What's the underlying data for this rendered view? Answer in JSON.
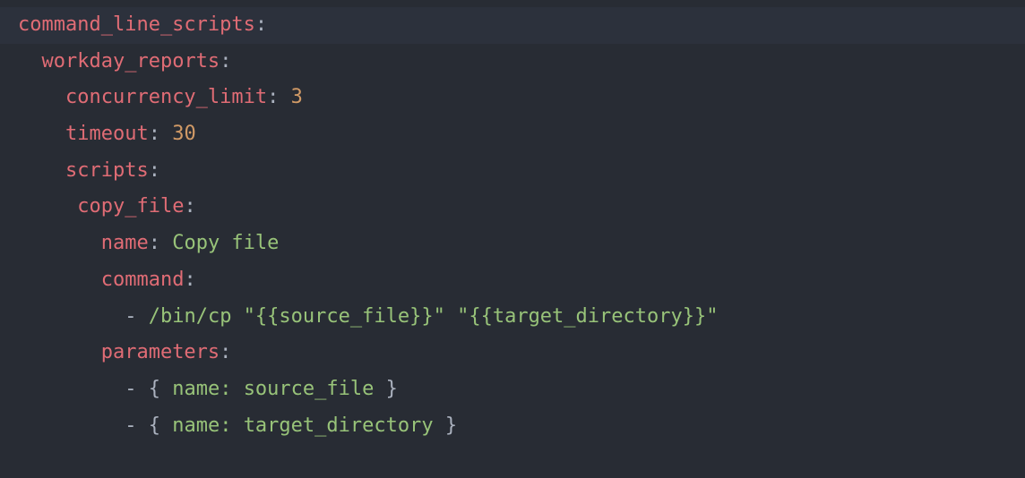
{
  "lines": [
    {
      "indent": 0,
      "highlighted": true,
      "segments": [
        {
          "type": "key",
          "text": "command_line_scripts"
        },
        {
          "type": "colon",
          "text": ":"
        }
      ]
    },
    {
      "indent": 1,
      "segments": [
        {
          "type": "key",
          "text": "workday_reports"
        },
        {
          "type": "colon",
          "text": ":"
        }
      ]
    },
    {
      "indent": 2,
      "segments": [
        {
          "type": "key",
          "text": "concurrency_limit"
        },
        {
          "type": "colon",
          "text": ": "
        },
        {
          "type": "number",
          "text": "3"
        }
      ]
    },
    {
      "indent": 2,
      "segments": [
        {
          "type": "key",
          "text": "timeout"
        },
        {
          "type": "colon",
          "text": ": "
        },
        {
          "type": "number",
          "text": "30"
        }
      ]
    },
    {
      "indent": 2,
      "segments": [
        {
          "type": "key",
          "text": "scripts"
        },
        {
          "type": "colon",
          "text": ":"
        }
      ]
    },
    {
      "indent": 2,
      "extraSpace": 1,
      "segments": [
        {
          "type": "key",
          "text": "copy_file"
        },
        {
          "type": "colon",
          "text": ":"
        }
      ]
    },
    {
      "indent": 3,
      "extraSpace": 1,
      "segments": [
        {
          "type": "key",
          "text": "name"
        },
        {
          "type": "colon",
          "text": ": "
        },
        {
          "type": "string",
          "text": "Copy file"
        }
      ]
    },
    {
      "indent": 3,
      "extraSpace": 1,
      "segments": [
        {
          "type": "key",
          "text": "command"
        },
        {
          "type": "colon",
          "text": ":"
        }
      ]
    },
    {
      "indent": 4,
      "extraSpace": 1,
      "segments": [
        {
          "type": "dash",
          "text": "- "
        },
        {
          "type": "string",
          "text": "/bin/cp \"{{source_file}}\" \"{{target_directory}}\""
        }
      ]
    },
    {
      "indent": 3,
      "extraSpace": 1,
      "segments": [
        {
          "type": "key",
          "text": "parameters"
        },
        {
          "type": "colon",
          "text": ":"
        }
      ]
    },
    {
      "indent": 4,
      "extraSpace": 1,
      "segments": [
        {
          "type": "dash",
          "text": "- "
        },
        {
          "type": "brace",
          "text": "{ "
        },
        {
          "type": "string",
          "text": "name: source_file"
        },
        {
          "type": "brace",
          "text": " }"
        }
      ]
    },
    {
      "indent": 4,
      "extraSpace": 1,
      "segments": [
        {
          "type": "dash",
          "text": "- "
        },
        {
          "type": "brace",
          "text": "{ "
        },
        {
          "type": "string",
          "text": "name: target_directory"
        },
        {
          "type": "brace",
          "text": " }"
        }
      ]
    }
  ]
}
